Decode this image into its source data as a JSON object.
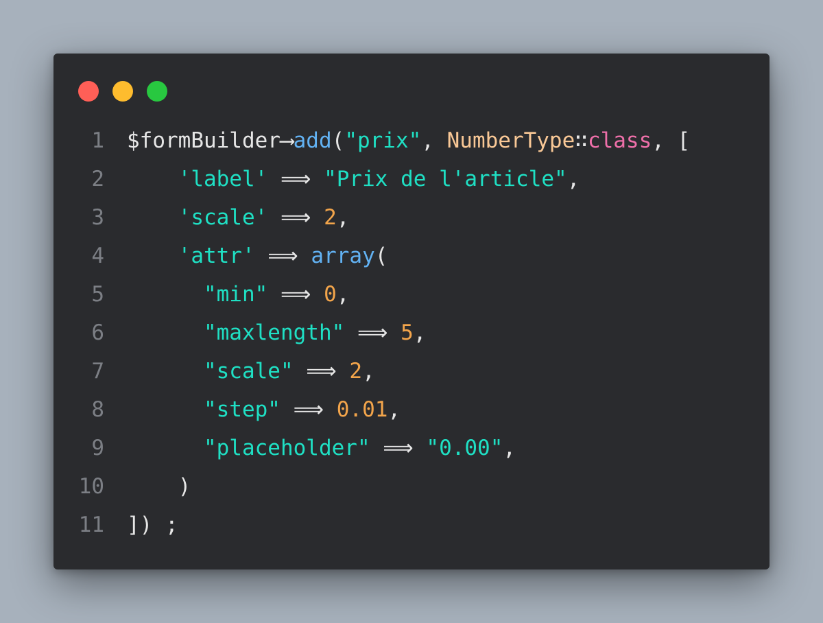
{
  "window": {
    "controls": [
      {
        "name": "close",
        "color": "#ff5f57"
      },
      {
        "name": "minimize",
        "color": "#febc2e"
      },
      {
        "name": "zoom",
        "color": "#28c840"
      }
    ]
  },
  "colors": {
    "background": "#a7b1bc",
    "editor_bg": "#2a2b2e",
    "line_number": "#7c7f85",
    "default": "#e6e6e6",
    "function": "#62b2f3",
    "string": "#1fe0c4",
    "class": "#f9c896",
    "keyword": "#ee6fa9",
    "number": "#f3a54b"
  },
  "code": {
    "lines": [
      {
        "number": "1",
        "indent": "",
        "tokens": [
          {
            "text": "$formBuilder",
            "type": "default"
          },
          {
            "text": "⟶",
            "type": "op"
          },
          {
            "text": "add",
            "type": "func"
          },
          {
            "text": "(",
            "type": "punc"
          },
          {
            "text": "\"prix\"",
            "type": "str"
          },
          {
            "text": ", ",
            "type": "punc"
          },
          {
            "text": "NumberType",
            "type": "cls"
          },
          {
            "text": "∷",
            "type": "op"
          },
          {
            "text": "class",
            "type": "kw"
          },
          {
            "text": ", [",
            "type": "punc"
          }
        ]
      },
      {
        "number": "2",
        "indent": "    ",
        "tokens": [
          {
            "text": "'label'",
            "type": "str"
          },
          {
            "text": " ⟹ ",
            "type": "op"
          },
          {
            "text": "\"Prix de l'article\"",
            "type": "str"
          },
          {
            "text": ",",
            "type": "punc"
          }
        ]
      },
      {
        "number": "3",
        "indent": "    ",
        "tokens": [
          {
            "text": "'scale'",
            "type": "str"
          },
          {
            "text": " ⟹ ",
            "type": "op"
          },
          {
            "text": "2",
            "type": "num"
          },
          {
            "text": ",",
            "type": "punc"
          }
        ]
      },
      {
        "number": "4",
        "indent": "    ",
        "tokens": [
          {
            "text": "'attr'",
            "type": "str"
          },
          {
            "text": " ⟹ ",
            "type": "op"
          },
          {
            "text": "array",
            "type": "func"
          },
          {
            "text": "(",
            "type": "punc"
          }
        ]
      },
      {
        "number": "5",
        "indent": "      ",
        "tokens": [
          {
            "text": "\"min\"",
            "type": "str"
          },
          {
            "text": " ⟹ ",
            "type": "op"
          },
          {
            "text": "0",
            "type": "num"
          },
          {
            "text": ",",
            "type": "punc"
          }
        ]
      },
      {
        "number": "6",
        "indent": "      ",
        "tokens": [
          {
            "text": "\"maxlength\"",
            "type": "str"
          },
          {
            "text": " ⟹ ",
            "type": "op"
          },
          {
            "text": "5",
            "type": "num"
          },
          {
            "text": ",",
            "type": "punc"
          }
        ]
      },
      {
        "number": "7",
        "indent": "      ",
        "tokens": [
          {
            "text": "\"scale\"",
            "type": "str"
          },
          {
            "text": " ⟹ ",
            "type": "op"
          },
          {
            "text": "2",
            "type": "num"
          },
          {
            "text": ",",
            "type": "punc"
          }
        ]
      },
      {
        "number": "8",
        "indent": "      ",
        "tokens": [
          {
            "text": "\"step\"",
            "type": "str"
          },
          {
            "text": " ⟹ ",
            "type": "op"
          },
          {
            "text": "0.01",
            "type": "num"
          },
          {
            "text": ",",
            "type": "punc"
          }
        ]
      },
      {
        "number": "9",
        "indent": "      ",
        "tokens": [
          {
            "text": "\"placeholder\"",
            "type": "str"
          },
          {
            "text": " ⟹ ",
            "type": "op"
          },
          {
            "text": "\"0.00\"",
            "type": "str"
          },
          {
            "text": ",",
            "type": "punc"
          }
        ]
      },
      {
        "number": "10",
        "indent": "    ",
        "tokens": [
          {
            "text": ")",
            "type": "punc"
          }
        ]
      },
      {
        "number": "11",
        "indent": "",
        "tokens": [
          {
            "text": "]) ;",
            "type": "punc"
          }
        ]
      }
    ]
  }
}
